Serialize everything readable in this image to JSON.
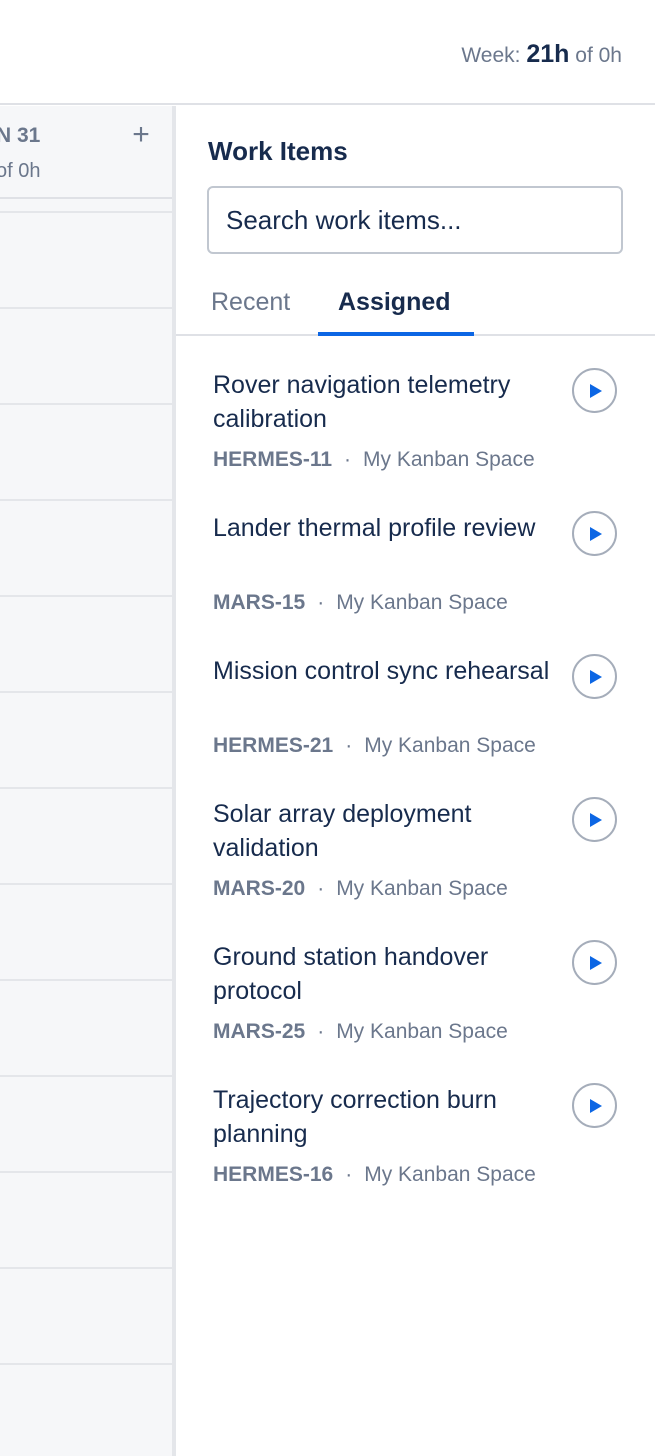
{
  "header": {
    "week_label": "Week:",
    "week_hours": "21h",
    "week_of": "of 0h"
  },
  "calendar": {
    "day_label": "N 31",
    "day_total": "of 0h",
    "add_icon": "plus-icon"
  },
  "panel": {
    "title": "Work Items",
    "search_placeholder": "Search work items...",
    "tabs": [
      {
        "label": "Recent",
        "active": false
      },
      {
        "label": "Assigned",
        "active": true
      }
    ],
    "items": [
      {
        "title": "Rover navigation telemetry calibration",
        "key": "HERMES-11",
        "separator": "·",
        "space": "My Kanban Space"
      },
      {
        "title": "Lander thermal profile review",
        "key": "MARS-15",
        "separator": "·",
        "space": "My Kanban Space"
      },
      {
        "title": "Mission control sync rehearsal",
        "key": "HERMES-21",
        "separator": "·",
        "space": "My Kanban Space"
      },
      {
        "title": "Solar array deployment validation",
        "key": "MARS-20",
        "separator": "·",
        "space": "My Kanban Space"
      },
      {
        "title": "Ground station handover protocol",
        "key": "MARS-25",
        "separator": "·",
        "space": "My Kanban Space"
      },
      {
        "title": "Trajectory correction burn planning",
        "key": "HERMES-16",
        "separator": "·",
        "space": "My Kanban Space"
      }
    ],
    "play_icon": "play-icon"
  },
  "colors": {
    "accent": "#0c66e4",
    "text": "#172b4d",
    "muted": "#6b778c",
    "calendar_bg": "#f6f7f9"
  }
}
